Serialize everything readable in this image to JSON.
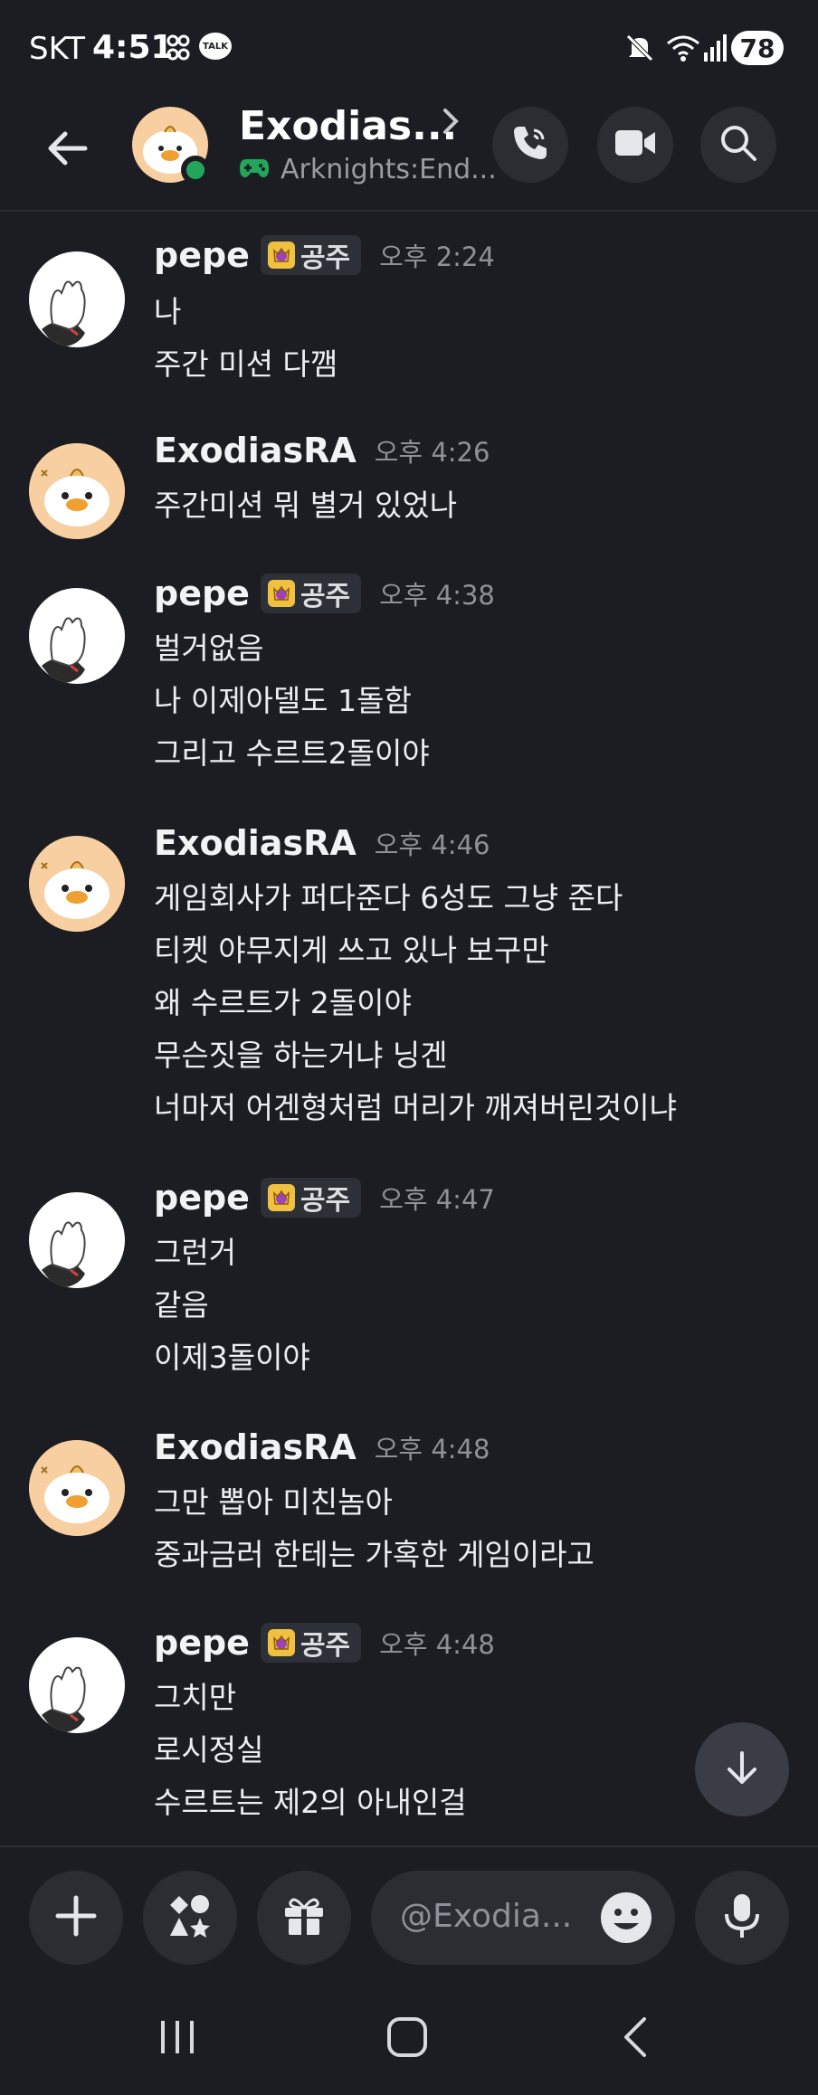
{
  "status_bar": {
    "carrier": "SKT",
    "time": "4:51",
    "battery": "78",
    "talk_badge": "TALK",
    "icons": [
      "grid-icon",
      "talk-icon",
      "mute-icon",
      "wifi-icon",
      "signal-icon",
      "battery-icon"
    ]
  },
  "header": {
    "title": "Exodias...",
    "activity": "Arknights:End...",
    "online": true,
    "buttons": [
      "call-icon",
      "video-icon",
      "search-icon"
    ]
  },
  "messages": [
    {
      "author": "pepe",
      "badge": "공주",
      "time": "오후 2:24",
      "avatar": "pepe",
      "lines": [
        "나",
        "주간 미션 다깸"
      ]
    },
    {
      "author": "ExodiasRA",
      "badge": "",
      "time": "오후 4:26",
      "avatar": "duck",
      "lines": [
        "주간미션 뭐 별거 있었나"
      ]
    },
    {
      "author": "pepe",
      "badge": "공주",
      "time": "오후 4:38",
      "avatar": "pepe",
      "lines": [
        "벌거없음",
        "나 이제아델도 1돌함",
        "그리고 수르트2돌이야"
      ]
    },
    {
      "author": "ExodiasRA",
      "badge": "",
      "time": "오후 4:46",
      "avatar": "duck",
      "lines": [
        "게임회사가 퍼다준다 6성도 그냥 준다",
        "티켓 야무지게 쓰고 있나 보구만",
        "왜 수르트가 2돌이야",
        "무슨짓을 하는거냐 닝겐",
        "너마저 어겐형처럼 머리가 깨져버린것이냐"
      ]
    },
    {
      "author": "pepe",
      "badge": "공주",
      "time": "오후 4:47",
      "avatar": "pepe",
      "lines": [
        "그런거",
        "같음",
        "이제3돌이야"
      ]
    },
    {
      "author": "ExodiasRA",
      "badge": "",
      "time": "오후 4:48",
      "avatar": "duck",
      "lines": [
        "그만 뽑아 미친놈아",
        "중과금러 한테는 가혹한 게임이라고"
      ]
    },
    {
      "author": "pepe",
      "badge": "공주",
      "time": "오후 4:48",
      "avatar": "pepe",
      "lines": [
        "그치만",
        "로시정실",
        "수르트는 제2의 아내인걸"
      ]
    }
  ],
  "composer": {
    "placeholder": "@Exodia...",
    "buttons": [
      "plus-icon",
      "apps-icon",
      "gift-icon",
      "emoji-icon",
      "mic-icon"
    ]
  },
  "colors": {
    "background": "#1c1d22",
    "surface": "#2b2d33",
    "online": "#23a55a",
    "duck_avatar_bg": "#f7cfa0"
  }
}
